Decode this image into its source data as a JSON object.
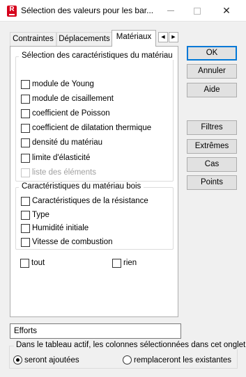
{
  "window": {
    "title": "Sélection des valeurs pour les bar...",
    "app_icon_letter": "R",
    "minimize_glyph": "",
    "maximize_glyph": "",
    "close_glyph": "✕"
  },
  "tabs": [
    {
      "label": "Contraintes",
      "active": false
    },
    {
      "label": "Déplacements",
      "active": false
    },
    {
      "label": "Matériaux",
      "active": true
    }
  ],
  "tab_scroll": {
    "left": "◀",
    "right": "▶"
  },
  "material_group": {
    "title": "Sélection des caractéristiques du matériau",
    "items": [
      {
        "label": "module de Young",
        "checked": false,
        "disabled": false
      },
      {
        "label": "module de cisaillement",
        "checked": false,
        "disabled": false
      },
      {
        "label": "coefficient de Poisson",
        "checked": false,
        "disabled": false
      },
      {
        "label": "coefficient de dilatation thermique",
        "checked": false,
        "disabled": false
      },
      {
        "label": "densité du matériau",
        "checked": false,
        "disabled": false
      },
      {
        "label": "limite d'élasticité",
        "checked": false,
        "disabled": false
      },
      {
        "label": "liste des éléments",
        "checked": false,
        "disabled": true
      }
    ]
  },
  "wood_group": {
    "title": "Caractéristiques du matériau bois",
    "items": [
      {
        "label": "Caractéristiques de la résistance",
        "checked": false
      },
      {
        "label": "Type",
        "checked": false
      },
      {
        "label": "Humidité initiale",
        "checked": false
      },
      {
        "label": "Vitesse de combustion",
        "checked": false
      }
    ]
  },
  "select_all": {
    "label": "tout",
    "checked": false
  },
  "select_none": {
    "label": "rien",
    "checked": false
  },
  "buttons": {
    "ok": "OK",
    "cancel": "Annuler",
    "help": "Aide",
    "filters": "Filtres",
    "extremes": "Extrêmes",
    "cases": "Cas",
    "points": "Points"
  },
  "results_field": {
    "value": "Efforts"
  },
  "table_options": {
    "title": "Dans le tableau actif, les colonnes sélectionnées dans cet onglet",
    "add_label": "seront ajoutées",
    "replace_label": "remplaceront les existantes",
    "selected": "add"
  },
  "colors": {
    "accent": "#0078d7",
    "app_icon": "#d6001c"
  }
}
